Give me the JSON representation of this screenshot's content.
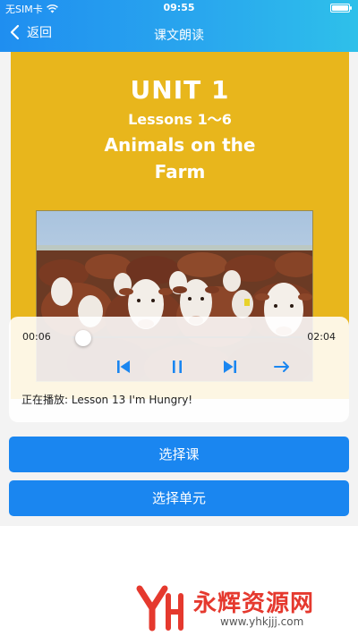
{
  "status": {
    "carrier": "无SIM卡",
    "time": "09:55"
  },
  "nav": {
    "back_label": "返回",
    "title": "课文朗读"
  },
  "cover": {
    "unit": "UNIT 1",
    "lessons": "Lessons 1～6",
    "title_line1": "Animals on the",
    "title_line2": "Farm"
  },
  "player": {
    "current_time": "00:06",
    "total_time": "02:04",
    "progress_fraction": 0.05,
    "now_playing": "正在播放: Lesson 13 I'm Hungry!",
    "controls": [
      "previous-icon",
      "pause-icon",
      "next-icon",
      "arrow-right-icon"
    ]
  },
  "buttons": {
    "select_lesson": "选择课",
    "select_unit": "选择单元"
  },
  "watermark": {
    "name": "永辉资源网",
    "url": "www.yhkjjj.com"
  },
  "colors": {
    "accent": "#1a86f0",
    "cover": "#e8b61c",
    "watermark": "#e5392e"
  }
}
